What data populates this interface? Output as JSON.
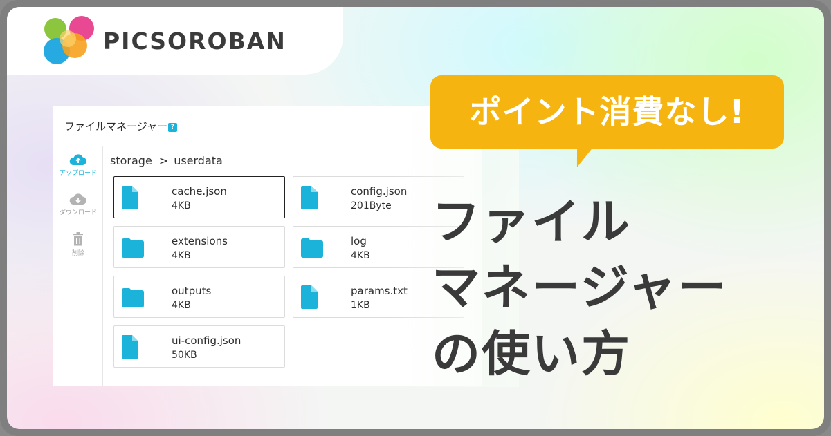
{
  "brand": {
    "name": "PICSOROBAN",
    "colors": {
      "cyan": "#1bb3d9",
      "yellow": "#f6b411",
      "text": "#3a3a3a"
    }
  },
  "file_manager": {
    "title": "ファイルマネージャー",
    "help_icon": "?",
    "sidebar": [
      {
        "icon": "cloud-upload-icon",
        "label": "アップロード",
        "active": true
      },
      {
        "icon": "cloud-download-icon",
        "label": "ダウンロード",
        "active": false
      },
      {
        "icon": "trash-icon",
        "label": "削除",
        "active": false
      }
    ],
    "breadcrumb": {
      "root": "storage",
      "separator": ">",
      "current": "userdata"
    },
    "files": [
      {
        "name": "cache.json",
        "size": "4KB",
        "kind": "file",
        "selected": true
      },
      {
        "name": "config.json",
        "size": "201Byte",
        "kind": "file",
        "selected": false
      },
      {
        "name": "extensions",
        "size": "4KB",
        "kind": "folder",
        "selected": false
      },
      {
        "name": "log",
        "size": "4KB",
        "kind": "folder",
        "selected": false
      },
      {
        "name": "outputs",
        "size": "4KB",
        "kind": "folder",
        "selected": false
      },
      {
        "name": "params.txt",
        "size": "1KB",
        "kind": "file",
        "selected": false
      },
      {
        "name": "ui-config.json",
        "size": "50KB",
        "kind": "file",
        "selected": false
      }
    ]
  },
  "callout": "ポイント消費なし!",
  "headline": {
    "line1": "ファイル",
    "line2": "マネージャー",
    "line3": "の使い方"
  }
}
